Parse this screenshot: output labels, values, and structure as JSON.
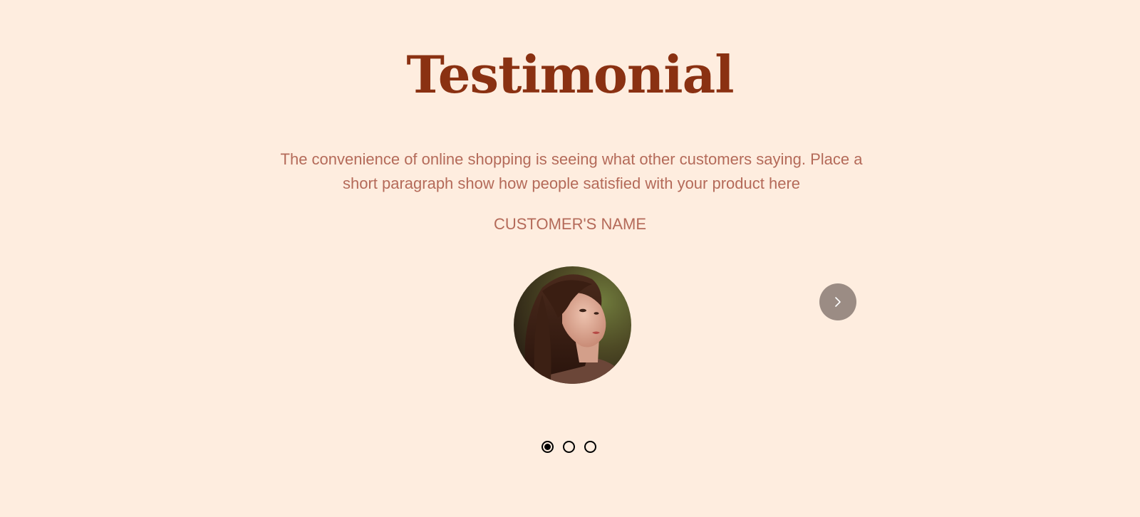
{
  "section": {
    "title": "Testimonial",
    "quote": "The convenience of online shopping is seeing what other customers saying. Place a short paragraph show how people satisfied with your product here",
    "customer_name": "CUSTOMER'S NAME"
  },
  "carousel": {
    "next_icon": "chevron-right-icon",
    "active_slide": 1,
    "slide_count": 3
  },
  "colors": {
    "background": "#FEEDDF",
    "title": "#8A3112",
    "body_text": "#B46A59",
    "nav_button": "#9B8C84"
  }
}
